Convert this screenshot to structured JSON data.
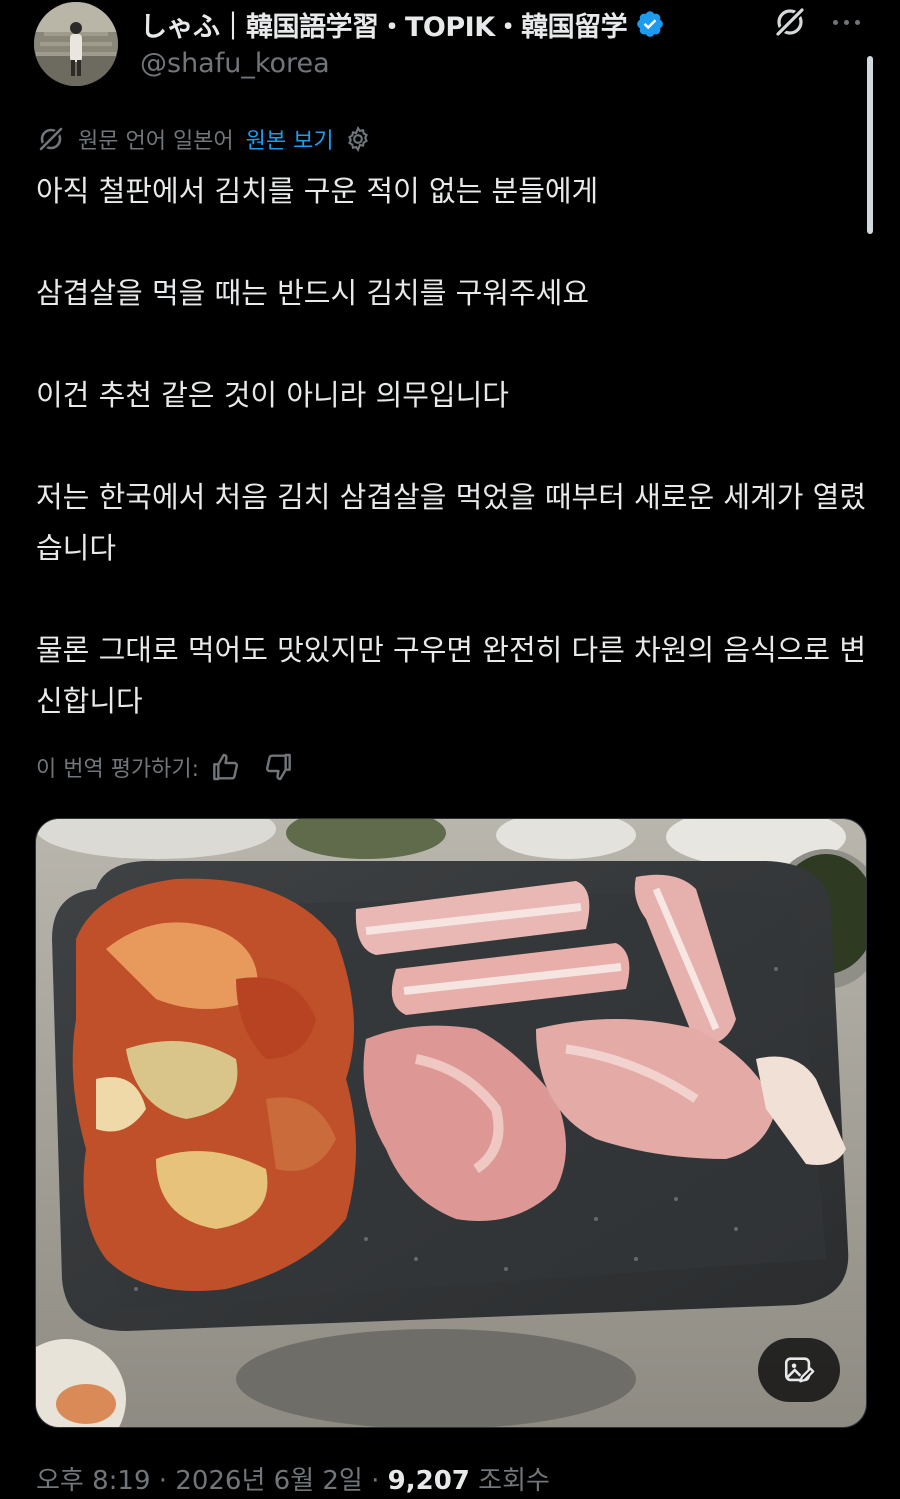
{
  "author": {
    "display_name": "しゃふ｜韓国語学習・TOPIK・韓国留学",
    "handle": "@shafu_korea",
    "verified": true
  },
  "icons": {
    "verified": "verified-badge-icon",
    "grok": "grok-icon",
    "more": "more-icon",
    "translate": "translate-icon",
    "settings": "gear-icon",
    "like": "thumbs-up-icon",
    "dislike": "thumbs-down-icon",
    "alt": "image-edit-icon"
  },
  "translation": {
    "label": "원문 언어 일본어",
    "view_original": "원본 보기",
    "rate_label": "이 번역 평가하기:"
  },
  "tweet": {
    "paragraphs": [
      "아직 철판에서 김치를 구운 적이 없는 분들에게",
      "삼겹살을 먹을 때는 반드시 김치를 구워주세요",
      "이건 추천 같은 것이 아니라 의무입니다",
      "저는 한국에서 처음 김치 삼겹살을 먹었을 때부터 새로운 세계가 열렸습니다",
      "물론 그대로 먹어도 맛있지만 구우면 완전히 다른 차원의 음식으로 변신합니다"
    ]
  },
  "meta": {
    "time": "오후 8:19",
    "separator": "·",
    "date": "2026년 6월 2일",
    "views_count": "9,207",
    "views_label": "조회수"
  },
  "colors": {
    "background": "#000000",
    "text": "#e7e9ea",
    "secondary": "#71767b",
    "link": "#1d9bf0"
  }
}
